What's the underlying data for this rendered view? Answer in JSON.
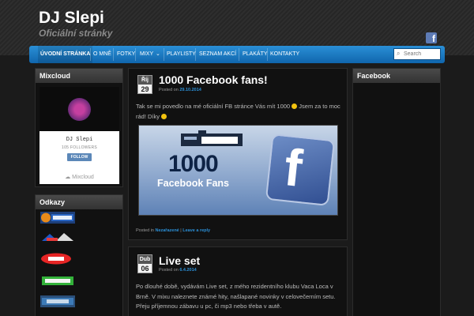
{
  "site": {
    "title": "DJ Slepi",
    "description": "Oficiální stránky",
    "facebook_glyph": "f"
  },
  "nav": {
    "items": [
      {
        "label": "ÚVODNÍ STRÁNKA",
        "active": true
      },
      {
        "label": "O MNĚ"
      },
      {
        "label": "FOTKY"
      },
      {
        "label": "MIXY",
        "has_dropdown": true,
        "dropdown_glyph": "⌄"
      },
      {
        "label": "PLAYLISTY"
      },
      {
        "label": "SEZNAM AKCÍ"
      },
      {
        "label": "PLAKÁTY"
      },
      {
        "label": "KONTAKTY"
      }
    ],
    "search_placeholder": "Search",
    "search_glyph": "⌕"
  },
  "sidebar_left": {
    "mixcloud": {
      "title": "Mixcloud",
      "card": {
        "name": "DJ Slepi",
        "followers": "105 FOLLOWERS",
        "follow_label": "FOLLOW",
        "footer": "Mixcloud",
        "footer_glyph": "☁"
      }
    },
    "links": {
      "title": "Odkazy",
      "logos": [
        {
          "name": "Frekvence 1"
        },
        {
          "name": "DJ Planet"
        },
        {
          "name": "Red"
        },
        {
          "name": "Kačko Rádio"
        },
        {
          "name": "Rádio"
        }
      ]
    }
  },
  "posts": [
    {
      "month": "Říj",
      "day": "29",
      "title": "1000 Facebook fans!",
      "posted_on_label": "Posted on",
      "date": "29.10.2014",
      "body": "Tak se mi povedlo na mé oficiální FB stránce Vás mít 1000",
      "body_cont": "Jsem za to moc rád! Díky",
      "banner": {
        "logo_text": "LIVE MIX DJ SLEPI",
        "big_number": "1000",
        "caption": "Facebook Fans",
        "fb_glyph": "f"
      },
      "footer_posted_in_label": "Posted in",
      "category": "Nezařazené",
      "separator": "|",
      "reply_label": "Leave a reply"
    },
    {
      "month": "Dub",
      "day": "06",
      "title": "Live set",
      "posted_on_label": "Posted on",
      "date": "6.4.2014",
      "body": "Po dlouhé době, vydávám Live set, z mého rezidentního klubu Vaca Loca v Brně. V mixu naleznete známé hity, našlapané novinky v celovečerním setu. Přeju příjemnou zábavu u pc, či mp3 nebo třeba v autě."
    }
  ],
  "sidebar_right": {
    "facebook": {
      "title": "Facebook"
    }
  },
  "colors": {
    "accent_blue": "#1f7bc4",
    "link_blue": "#2b8fd6",
    "bg": "#1b1b1b"
  }
}
